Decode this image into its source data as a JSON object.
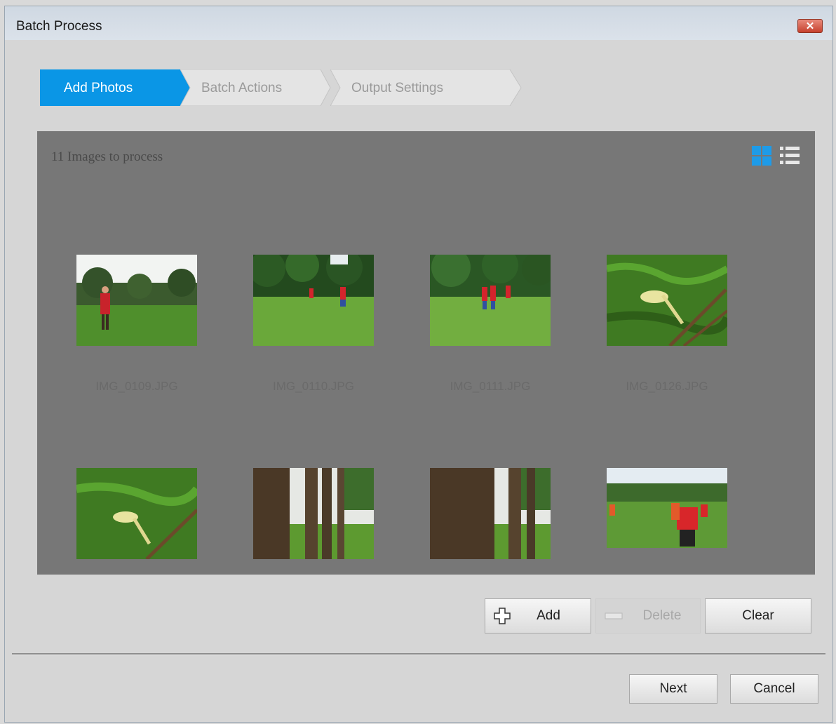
{
  "window": {
    "title": "Batch Process",
    "close_label": "✕"
  },
  "steps": [
    {
      "label": "Add Photos",
      "active": true
    },
    {
      "label": "Batch Actions",
      "active": false
    },
    {
      "label": "Output Settings",
      "active": false
    }
  ],
  "panel": {
    "count_text": "11 Images to process",
    "view_modes": [
      "grid-view-icon",
      "list-view-icon"
    ],
    "active_view": "grid"
  },
  "thumbnails": [
    {
      "filename": "IMG_0109.JPG",
      "scene": "field-person"
    },
    {
      "filename": "IMG_0110.JPG",
      "scene": "field-players"
    },
    {
      "filename": "IMG_0111.JPG",
      "scene": "field-players"
    },
    {
      "filename": "IMG_0126.JPG",
      "scene": "flower-grass"
    },
    {
      "filename": "",
      "scene": "flower-grass"
    },
    {
      "filename": "",
      "scene": "trees"
    },
    {
      "filename": "",
      "scene": "trees"
    },
    {
      "filename": "",
      "scene": "soccer-game"
    }
  ],
  "actions": {
    "add_label": "Add",
    "delete_label": "Delete",
    "clear_label": "Clear"
  },
  "footer": {
    "next_label": "Next",
    "cancel_label": "Cancel"
  },
  "colors": {
    "accent": "#0a96e6",
    "panel_bg": "#777777"
  }
}
